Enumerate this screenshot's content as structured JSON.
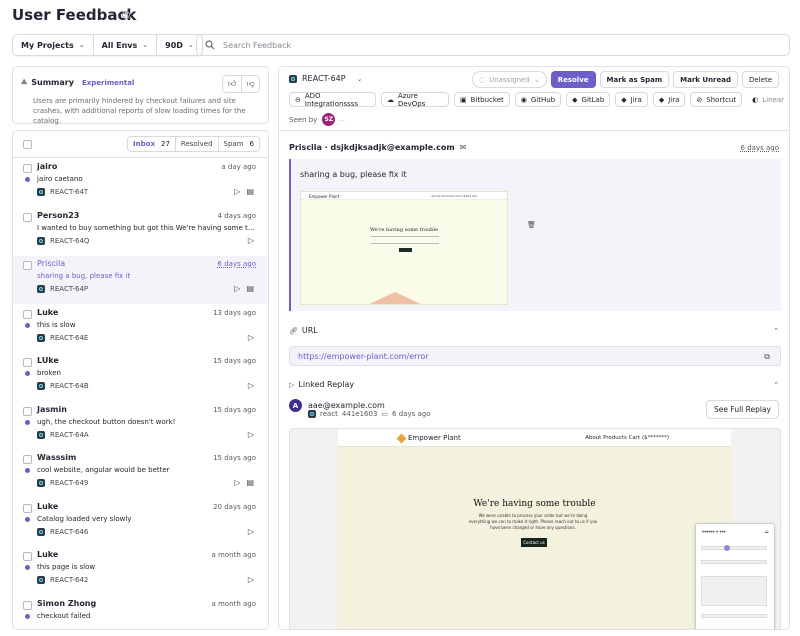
{
  "header": {
    "title": "User Feedback",
    "help": "?"
  },
  "filters": {
    "projects": "My Projects",
    "envs": "All Envs",
    "period": "90D"
  },
  "search": {
    "placeholder": "Search Feedback"
  },
  "summary": {
    "title": "Summary",
    "badge": "Experimental",
    "text": "Users are primarily hindered by checkout failures and site crashes, with additional reports of slow loading times for the catalog."
  },
  "tabs": [
    {
      "label": "Inbox",
      "count": "27"
    },
    {
      "label": "Resolved",
      "count": ""
    },
    {
      "label": "Spam",
      "count": "6"
    }
  ],
  "items": [
    {
      "name": "jairo",
      "date": "a day ago",
      "msg": "jairo caetano",
      "project": "REACT-64T",
      "replay": true,
      "shot": true,
      "unread": true
    },
    {
      "name": "Person23",
      "date": "4 days ago",
      "msg": "I wanted to buy something but got this We're having some trouble we are unable",
      "project": "REACT-64Q",
      "replay": true,
      "shot": false,
      "unread": false
    },
    {
      "name": "Priscila",
      "date": "6 days ago",
      "msg": "sharing a bug, please fix it",
      "project": "REACT-64P",
      "replay": true,
      "shot": true,
      "unread": false
    },
    {
      "name": "Luke",
      "date": "13 days ago",
      "msg": "this is slow",
      "project": "REACT-64E",
      "replay": true,
      "shot": false,
      "unread": true
    },
    {
      "name": "LUke",
      "date": "15 days ago",
      "msg": "broken",
      "project": "REACT-64B",
      "replay": true,
      "shot": false,
      "unread": true
    },
    {
      "name": "Jasmin",
      "date": "15 days ago",
      "msg": "ugh, the checkout button doesn't work!",
      "project": "REACT-64A",
      "replay": true,
      "shot": false,
      "unread": true
    },
    {
      "name": "Wasssim",
      "date": "15 days ago",
      "msg": "cool website, angular would be better",
      "project": "REACT-649",
      "replay": true,
      "shot": true,
      "unread": true
    },
    {
      "name": "Luke",
      "date": "20 days ago",
      "msg": "Catalog loaded very slowly",
      "project": "REACT-646",
      "replay": true,
      "shot": false,
      "unread": true
    },
    {
      "name": "Luke",
      "date": "a month ago",
      "msg": "this page is slow",
      "project": "REACT-642",
      "replay": true,
      "shot": false,
      "unread": true
    },
    {
      "name": "Simon Zhong",
      "date": "a month ago",
      "msg": "checkout failed",
      "project": "",
      "replay": false,
      "shot": false,
      "unread": true
    }
  ],
  "detail": {
    "project": "REACT-64P",
    "actions": {
      "assign": "Unassigned",
      "resolve": "Resolve",
      "spam": "Mark as Spam",
      "unread": "Mark Unread",
      "delete": "Delete"
    },
    "integrations": [
      "ADO Integrationssss",
      "Azure DevOps",
      "Bitbucket",
      "GitHub",
      "GitLab",
      "Jira",
      "Jira",
      "Shortcut",
      "Linear"
    ],
    "seen_by": "Seen by",
    "seen_avatar": "SZ",
    "from": "Priscila · dsjkdjksadjk@example.com",
    "date": "6 days ago",
    "message": "sharing a bug, please fix it",
    "shot": {
      "logo": "Empower Plant",
      "nav": "About   Products   Cart ($203.00)",
      "title": "We're having some trouble"
    },
    "url_label": "URL",
    "url": "https://empower-plant.com/error",
    "replay_label": "Linked Replay",
    "replay_user": "aae@example.com",
    "replay_project": "react",
    "replay_id": "441e1603",
    "replay_date": "6 days ago",
    "replay_avatar": "A",
    "full_replay": "See Full Replay",
    "replay_page": {
      "logo": "Empower Plant",
      "links": "About   Products   Cart ($*******)",
      "title": "We're having some trouble",
      "text": "We were unable to process your order but we're doing everything we can to make it right. Please reach out to us if you have been charged or have any questions.",
      "button": "Contact us",
      "form_title": "****** * ***"
    }
  },
  "colors": {
    "accent": "#6c5fc7",
    "text": "#2b2233",
    "border": "#e3dfe7"
  }
}
